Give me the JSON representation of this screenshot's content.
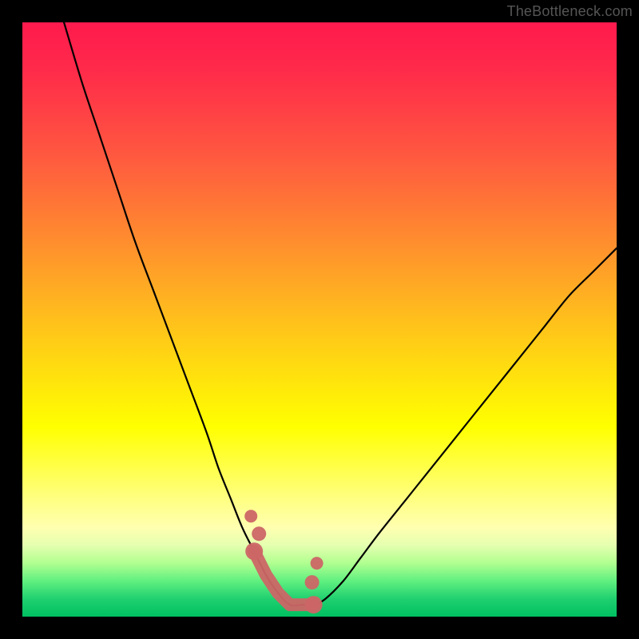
{
  "watermark": "TheBottleneck.com",
  "chart_data": {
    "type": "line",
    "title": "",
    "xlabel": "",
    "ylabel": "",
    "xlim": [
      0,
      100
    ],
    "ylim": [
      0,
      100
    ],
    "grid": false,
    "legend": false,
    "series": [
      {
        "name": "bottleneck-curve",
        "x": [
          7,
          10,
          13,
          16,
          19,
          22,
          25,
          28,
          31,
          33,
          35,
          37,
          39,
          41,
          43,
          45,
          47,
          49,
          51,
          54,
          57,
          60,
          64,
          68,
          72,
          76,
          80,
          84,
          88,
          92,
          96,
          100
        ],
        "values": [
          100,
          90,
          81,
          72,
          63,
          55,
          47,
          39,
          31,
          25,
          20,
          15,
          11,
          7,
          4,
          2,
          2,
          2,
          3,
          6,
          10,
          14,
          19,
          24,
          29,
          34,
          39,
          44,
          49,
          54,
          58,
          62
        ]
      }
    ],
    "annotations": [
      {
        "name": "trough-markers",
        "x_range": [
          33,
          49
        ],
        "y_range": [
          2,
          12
        ],
        "color": "#cc6666"
      }
    ],
    "background_gradient": {
      "direction": "top-to-bottom",
      "stops": [
        {
          "pos": 0.0,
          "color": "#ff1a4d"
        },
        {
          "pos": 0.36,
          "color": "#ff8a2f"
        },
        {
          "pos": 0.68,
          "color": "#ffff00"
        },
        {
          "pos": 0.88,
          "color": "#e5ffb0"
        },
        {
          "pos": 1.0,
          "color": "#00c060"
        }
      ]
    }
  }
}
